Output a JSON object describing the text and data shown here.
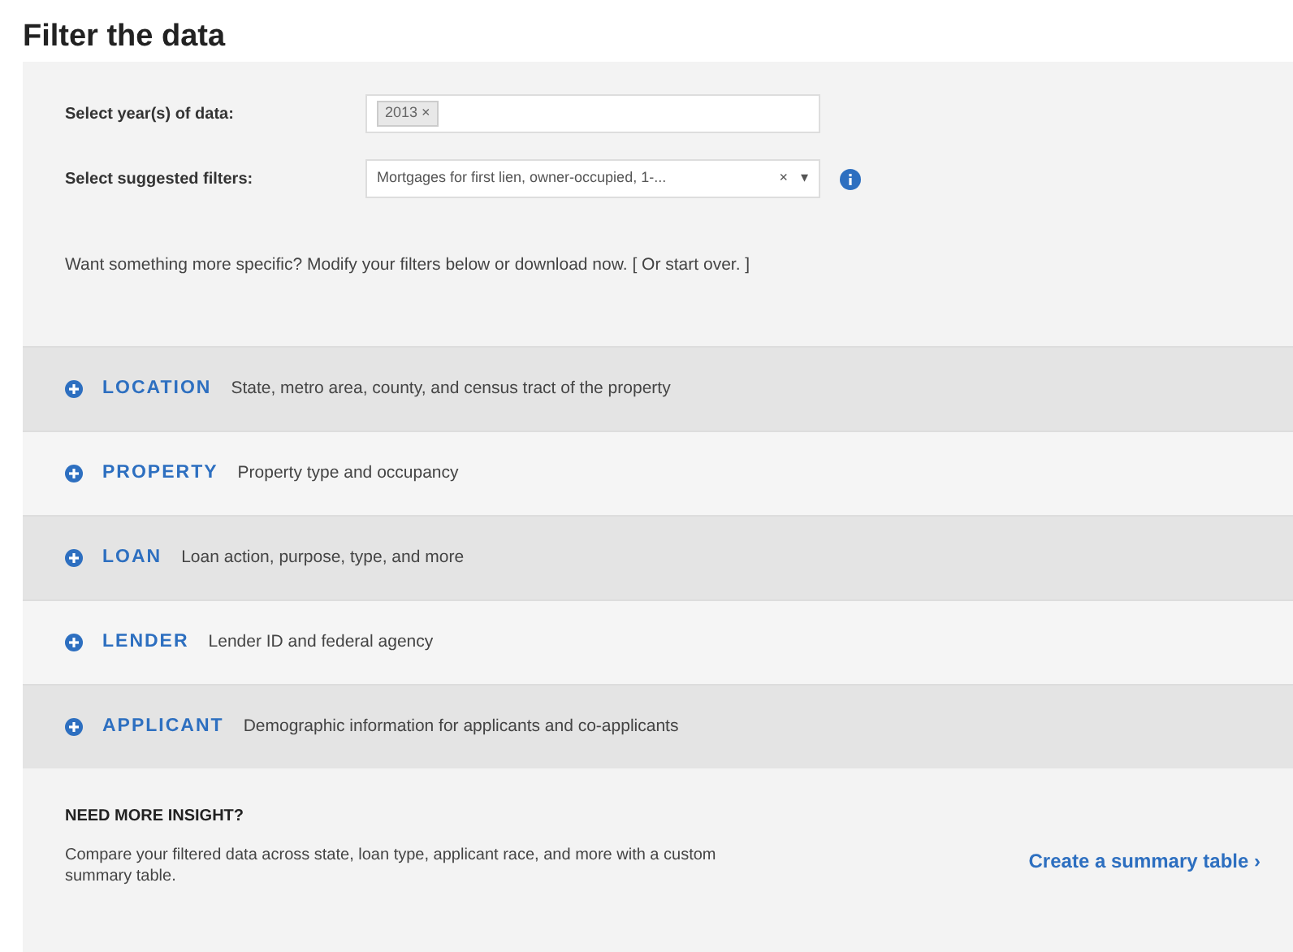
{
  "title": "Filter the data",
  "fields": [
    {
      "label": "Select year(s) of data:",
      "kind": "tags",
      "tags": [
        "2013"
      ],
      "tag_remove": "×"
    },
    {
      "label": "Select suggested filters:",
      "kind": "select",
      "value": "Mortgages for first lien, owner-occupied, 1-...",
      "clear": "×",
      "caret": "▾",
      "info": true
    }
  ],
  "hint": {
    "text": "Want something more specific? Modify your filters below or",
    "link": "download now.",
    "bracket_open": "[ Or",
    "link2": "start over.",
    "bracket_close": "]"
  },
  "sections": [
    {
      "name": "LOCATION",
      "description": "State, metro area, county, and census tract of the property",
      "expanded": false
    },
    {
      "name": "PROPERTY",
      "description": "Property type and occupancy",
      "expanded": false
    },
    {
      "name": "LOAN",
      "description": "Loan action, purpose, type, and more",
      "expanded": false
    },
    {
      "name": "LENDER",
      "description": "Lender ID and federal agency",
      "expanded": false
    },
    {
      "name": "APPLICANT",
      "description": "Demographic information for applicants and co-applicants",
      "expanded": false
    }
  ],
  "insight": {
    "heading": "NEED MORE INSIGHT?",
    "text": "Compare your filtered data across state, loan type, applicant race, and more with a custom summary table.",
    "link": "Create a summary table",
    "link_arrow": "›"
  }
}
